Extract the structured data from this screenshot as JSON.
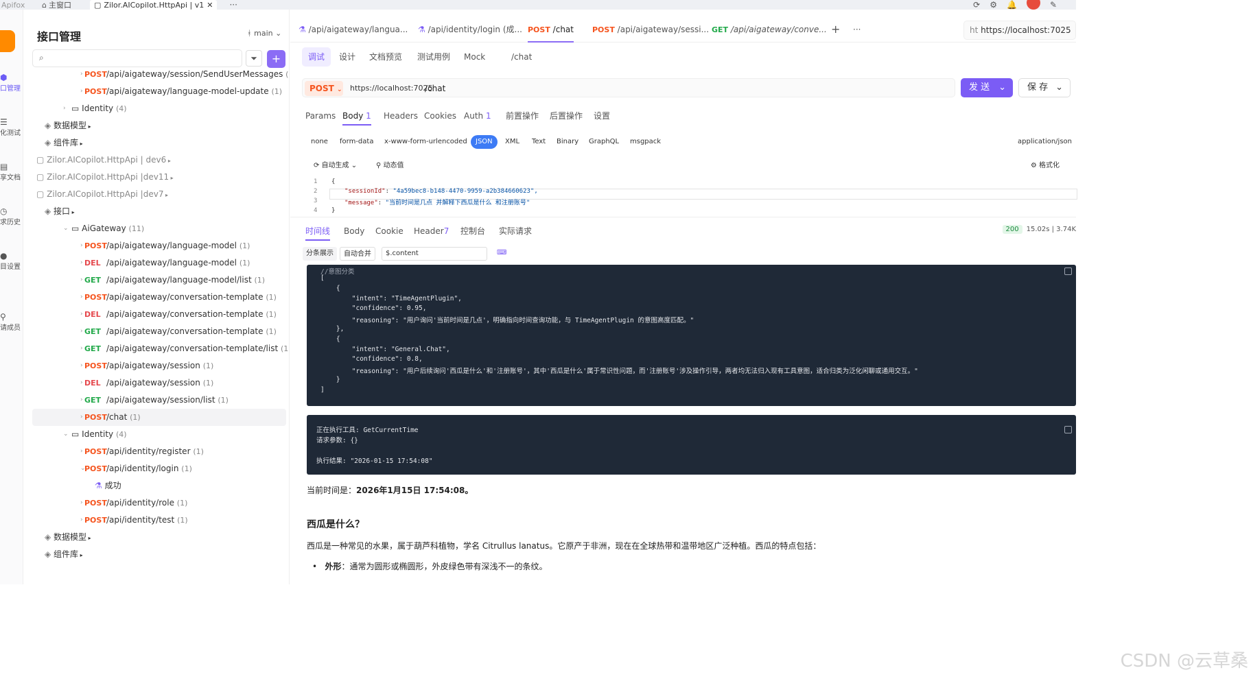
{
  "titlebar": {
    "app_name": "Apifox",
    "home_label": "主窗口",
    "tab_label": "Zilor.AICopilot.HttpApi | v1",
    "more": "···"
  },
  "rail": {
    "items": [
      {
        "label": "口管理",
        "icon": "api-icon"
      },
      {
        "label": "化测试",
        "icon": "test-icon"
      },
      {
        "label": "享文档",
        "icon": "doc-icon"
      },
      {
        "label": "求历史",
        "icon": "history-icon"
      },
      {
        "label": "目设置",
        "icon": "settings-icon"
      },
      {
        "label": "请成员",
        "icon": "members-icon"
      }
    ]
  },
  "sidebar": {
    "title": "接口管理",
    "branch": "main",
    "rows": [
      {
        "indent": 2,
        "method": "POST",
        "path": "/api/aigateway/session/SendUserMessages",
        "count": "(1)"
      },
      {
        "indent": 2,
        "method": "POST",
        "path": "/api/aigateway/language-model-update",
        "count": "(1)"
      },
      {
        "indent": 1,
        "folder": true,
        "path": "Identity",
        "count": "(4)"
      },
      {
        "indent": 0,
        "group": "数据模型"
      },
      {
        "indent": 0,
        "group": "组件库"
      },
      {
        "indent": -1,
        "project": "Zilor.AICopilot.HttpApi | dev6"
      },
      {
        "indent": -1,
        "project": "Zilor.AICopilot.HttpApi |dev11"
      },
      {
        "indent": -1,
        "project": "Zilor.AICopilot.HttpApi |dev7"
      },
      {
        "indent": 0,
        "group": "接口"
      },
      {
        "indent": 1,
        "folder": true,
        "open": true,
        "path": "AiGateway",
        "count": "(11)"
      },
      {
        "indent": 2,
        "method": "POST",
        "path": "/api/aigateway/language-model",
        "count": "(1)"
      },
      {
        "indent": 2,
        "method": "DEL",
        "path": "/api/aigateway/language-model",
        "count": "(1)"
      },
      {
        "indent": 2,
        "method": "GET",
        "path": "/api/aigateway/language-model/list",
        "count": "(1)"
      },
      {
        "indent": 2,
        "method": "POST",
        "path": "/api/aigateway/conversation-template",
        "count": "(1)"
      },
      {
        "indent": 2,
        "method": "DEL",
        "path": "/api/aigateway/conversation-template",
        "count": "(1)"
      },
      {
        "indent": 2,
        "method": "GET",
        "path": "/api/aigateway/conversation-template",
        "count": "(1)"
      },
      {
        "indent": 2,
        "method": "GET",
        "path": "/api/aigateway/conversation-template/list",
        "count": "(1)"
      },
      {
        "indent": 2,
        "method": "POST",
        "path": "/api/aigateway/session",
        "count": "(1)"
      },
      {
        "indent": 2,
        "method": "DEL",
        "path": "/api/aigateway/session",
        "count": "(1)"
      },
      {
        "indent": 2,
        "method": "GET",
        "path": "/api/aigateway/session/list",
        "count": "(1)"
      },
      {
        "indent": 2,
        "method": "POST",
        "path": "/chat",
        "count": "(1)",
        "selected": true
      },
      {
        "indent": 1,
        "folder": true,
        "open": true,
        "path": "Identity",
        "count": "(4)"
      },
      {
        "indent": 2,
        "method": "POST",
        "path": "/api/identity/register",
        "count": "(1)"
      },
      {
        "indent": 2,
        "method": "POST",
        "path": "/api/identity/login",
        "count": "(1)",
        "open": true
      },
      {
        "indent": 3,
        "example": "成功"
      },
      {
        "indent": 2,
        "method": "POST",
        "path": "/api/identity/role",
        "count": "(1)"
      },
      {
        "indent": 2,
        "method": "POST",
        "path": "/api/identity/test",
        "count": "(1)"
      },
      {
        "indent": 0,
        "group": "数据模型"
      },
      {
        "indent": 0,
        "group": "组件库"
      }
    ]
  },
  "tabs": {
    "items": [
      {
        "method": "",
        "label": "/api/aigateway/langua..."
      },
      {
        "method": "",
        "label": "/api/identity/login (成..."
      },
      {
        "method": "POST",
        "label": "/chat",
        "active": true
      },
      {
        "method": "POST",
        "label": "/api/aigateway/sessi..."
      },
      {
        "method": "GET",
        "label": "/api/aigateway/conve..."
      }
    ],
    "add": "+",
    "more": "···",
    "env_prefix": "ht",
    "env_url": "https://localhost:7025"
  },
  "subtabs": [
    "调试",
    "设计",
    "文档预览",
    "测试用例",
    "Mock",
    "/chat"
  ],
  "request": {
    "method": "POST",
    "host": "https://localhost:7025",
    "path": "/chat",
    "send_label": "发 送",
    "save_label": "保 存"
  },
  "param_tabs": [
    "Params",
    "Body",
    "1",
    "Headers",
    "Cookies",
    "Auth",
    "1",
    "前置操作",
    "后置操作",
    "设置"
  ],
  "body_types": [
    "none",
    "form-data",
    "x-www-form-urlencoded",
    "JSON",
    "XML",
    "Text",
    "Binary",
    "GraphQL",
    "msgpack"
  ],
  "content_type": "application/json",
  "editor": {
    "auto_gen": "自动生成",
    "dynamic": "动态值",
    "format": "格式化",
    "lines": [
      {
        "n": "1",
        "text": "{"
      },
      {
        "n": "2",
        "key": "\"sessionId\"",
        "value": "\"4a59bec8-b148-4470-9959-a2b384660623\","
      },
      {
        "n": "3",
        "key": "\"message\"",
        "value": "\"当前时间是几点 并解释下西瓜是什么 和注册账号\""
      },
      {
        "n": "4",
        "text": "}"
      }
    ]
  },
  "response": {
    "tabs": [
      "时间线",
      "Body",
      "Cookie",
      "Header",
      "7",
      "控制台",
      "实际请求"
    ],
    "status": "200",
    "time": "15.02s",
    "size": "3.74K",
    "split_label": "分条展示",
    "merge_label": "自动合并",
    "jsonpath": "$.content"
  },
  "intent_panel": {
    "comment": "//意图分类",
    "lines": [
      "[",
      "    {",
      "        \"intent\": \"TimeAgentPlugin\",",
      "        \"confidence\": 0.95,",
      "        \"reasoning\": \"用户询问'当前时间是几点'，明确指向时间查询功能，与 TimeAgentPlugin 的意图高度匹配。\"",
      "    },",
      "    {",
      "        \"intent\": \"General.Chat\",",
      "        \"confidence\": 0.8,",
      "        \"reasoning\": \"用户后续询问'西瓜是什么'和'注册账号'，其中'西瓜是什么'属于常识性问题，而'注册账号'涉及操作引导，两者均无法归入现有工具意图，适合归类为泛化闲聊或通用交互。\"",
      "    }",
      "]"
    ]
  },
  "tool_panel": {
    "lines": [
      "正在执行工具: GetCurrentTime",
      "请求参数: {}",
      "",
      "执行结果: \"2026-01-15 17:54:08\""
    ]
  },
  "answer": {
    "time_prefix": "当前时间是：",
    "time_value": "2026年1月15日 17:54:08。",
    "heading": "西瓜是什么？",
    "para": "西瓜是一种常见的水果，属于葫芦科植物，学名 Citrullus lanatus。它原产于非洲，现在在全球热带和温带地区广泛种植。西瓜的特点包括：",
    "bullet_title": "外形",
    "bullet_text": "：通常为圆形或椭圆形，外皮绿色带有深浅不一的条纹。"
  },
  "watermark": "CSDN @云草桑"
}
